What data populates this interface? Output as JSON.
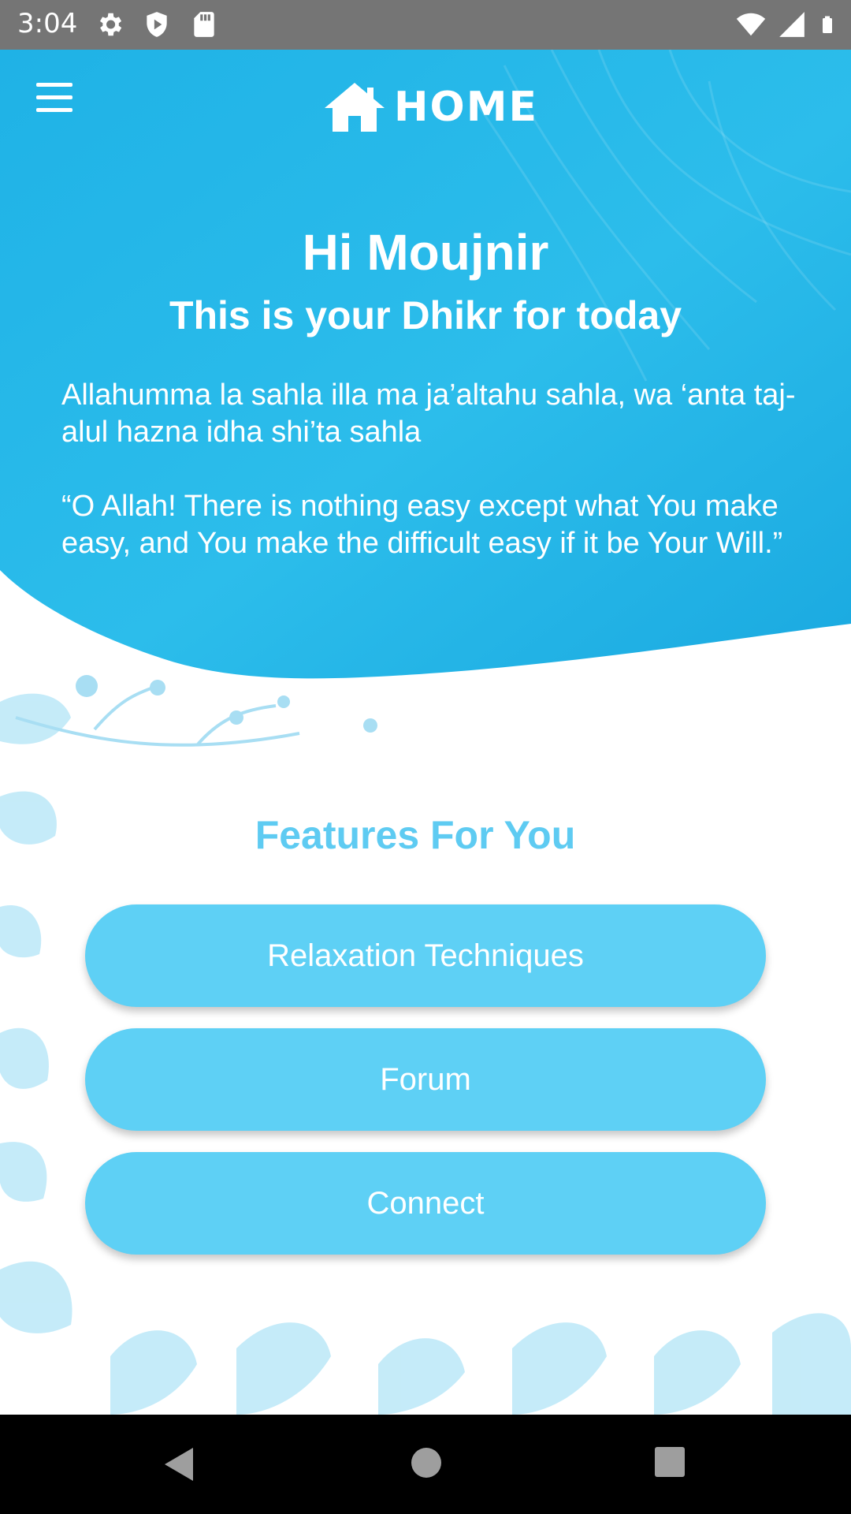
{
  "status_bar": {
    "time": "3:04",
    "left_icons": [
      "settings-gear-icon",
      "shield-icon",
      "sd-card-icon"
    ],
    "right_icons": [
      "wifi-icon",
      "cellular-signal-icon",
      "battery-icon"
    ],
    "color": "#757575"
  },
  "app_bar": {
    "title": "HOME",
    "menu_icon": "hamburger-menu-icon",
    "title_icon": "house-icon"
  },
  "hero": {
    "greeting": "Hi Moujnir",
    "subtitle": "This is your Dhikr for today",
    "dhikr_transliteration": "Allahumma la sahla illa ma ja’altahu sahla, wa ‘anta taj-alul hazna idha shi’ta sahla",
    "dhikr_translation": "“O Allah! There is nothing easy except what You make easy, and You make the difficult easy if it be Your Will.”",
    "background_color": "#1eb4e8"
  },
  "features": {
    "heading": "Features For You",
    "buttons": [
      {
        "label": "Relaxation Techniques"
      },
      {
        "label": "Forum"
      },
      {
        "label": "Connect"
      }
    ],
    "accent_color": "#5ed0f5"
  },
  "nav_bar": {
    "icons": [
      "back-icon",
      "home-circle-icon",
      "recents-square-icon"
    ]
  }
}
